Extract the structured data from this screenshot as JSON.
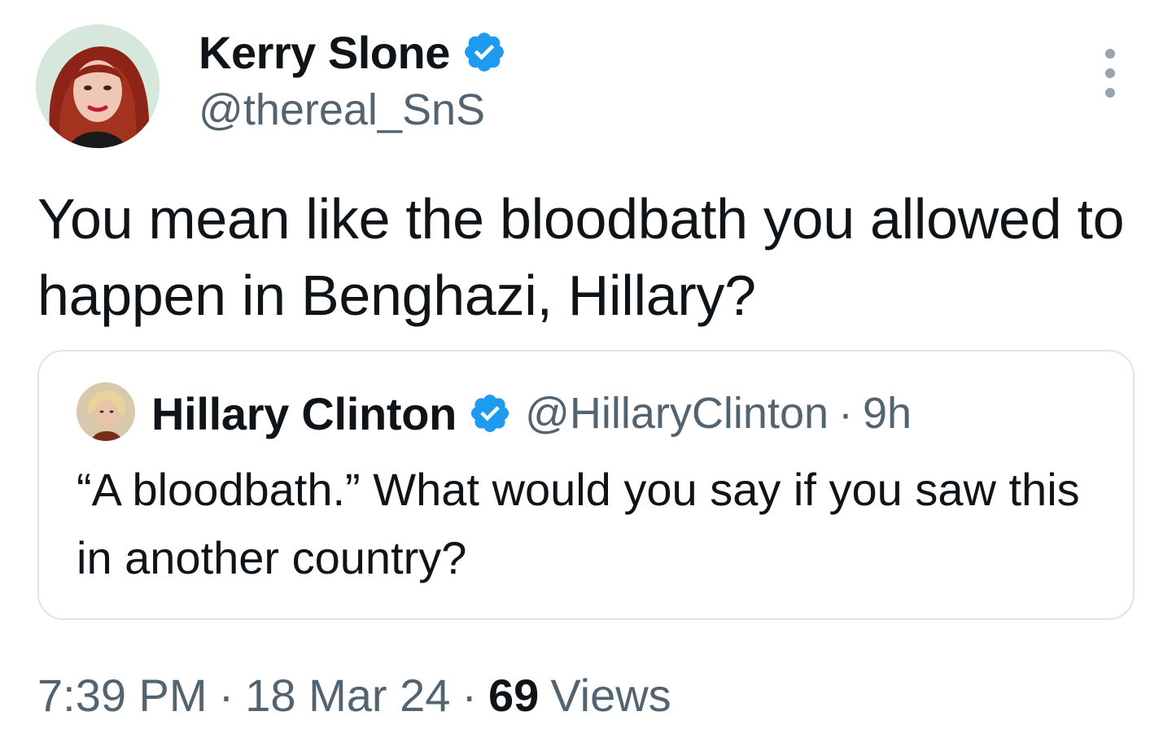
{
  "author": {
    "display_name": "Kerry Slone",
    "handle": "@thereal_SnS",
    "verified": true
  },
  "tweet": {
    "text": "You mean like the bloodbath you allowed to happen in Benghazi, Hillary?"
  },
  "quoted_tweet": {
    "display_name": "Hillary Clinton",
    "handle": "@HillaryClinton",
    "separator": "·",
    "time": "9h",
    "verified": true,
    "text": "“A bloodbath.” What would you say if you saw this in another country?"
  },
  "footer": {
    "time": "7:39 PM",
    "separator": "·",
    "date": "18 Mar 24",
    "views_count": "69",
    "views_label": "Views"
  },
  "colors": {
    "verified_badge": "#1d9bf0",
    "primary_text": "#0f1419",
    "secondary_text": "#536471",
    "card_border": "#dfe3e7"
  },
  "icons": {
    "verified": "verified-badge-icon",
    "more": "more-options-icon"
  }
}
